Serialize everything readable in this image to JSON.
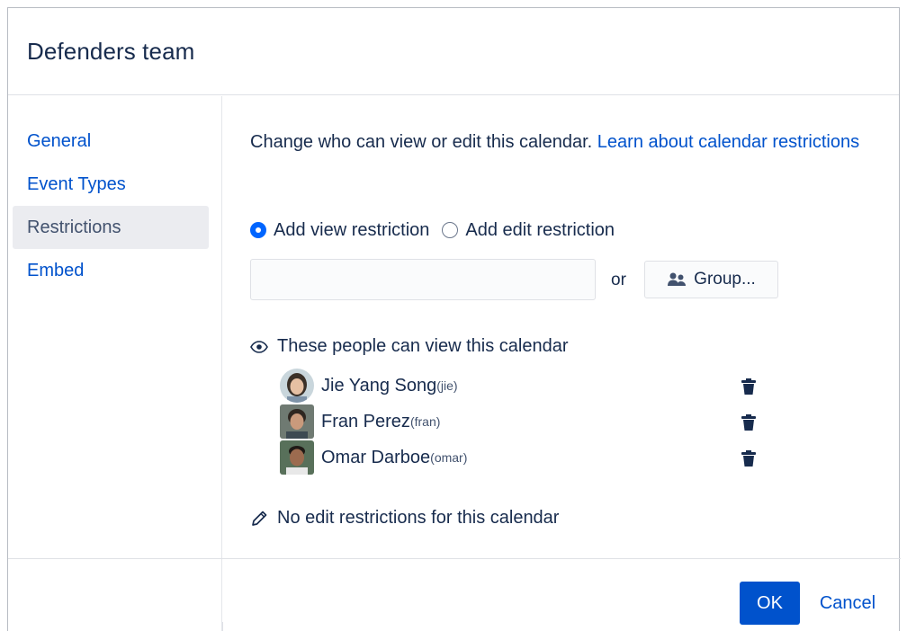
{
  "dialog": {
    "title": "Defenders team"
  },
  "sidebar": {
    "items": [
      {
        "label": "General",
        "active": false
      },
      {
        "label": "Event Types",
        "active": false
      },
      {
        "label": "Restrictions",
        "active": true
      },
      {
        "label": "Embed",
        "active": false
      }
    ]
  },
  "restrictions": {
    "intro_text": "Change who can view or edit this calendar.",
    "intro_link": "Learn about calendar restrictions",
    "radio_view_label": "Add view restriction",
    "radio_edit_label": "Add edit restriction",
    "selected_radio": "view",
    "user_input_value": "",
    "or_text": "or",
    "group_button_label": "Group...",
    "view_heading": "These people can view this calendar",
    "people": [
      {
        "name": "Jie Yang Song",
        "handle": "(jie)"
      },
      {
        "name": "Fran Perez",
        "handle": "(fran)"
      },
      {
        "name": "Omar Darboe",
        "handle": "(omar)"
      }
    ],
    "edit_note": "No edit restrictions for this calendar"
  },
  "footer": {
    "ok_label": "OK",
    "cancel_label": "Cancel"
  },
  "icons": {
    "group": "group-icon",
    "eye": "eye-icon",
    "trash": "trash-icon",
    "pencil": "pencil-icon"
  },
  "colors": {
    "link": "#0052cc",
    "primary": "#0052cc",
    "radio_checked": "#0065ff",
    "active_nav_bg": "#ebecf0"
  }
}
